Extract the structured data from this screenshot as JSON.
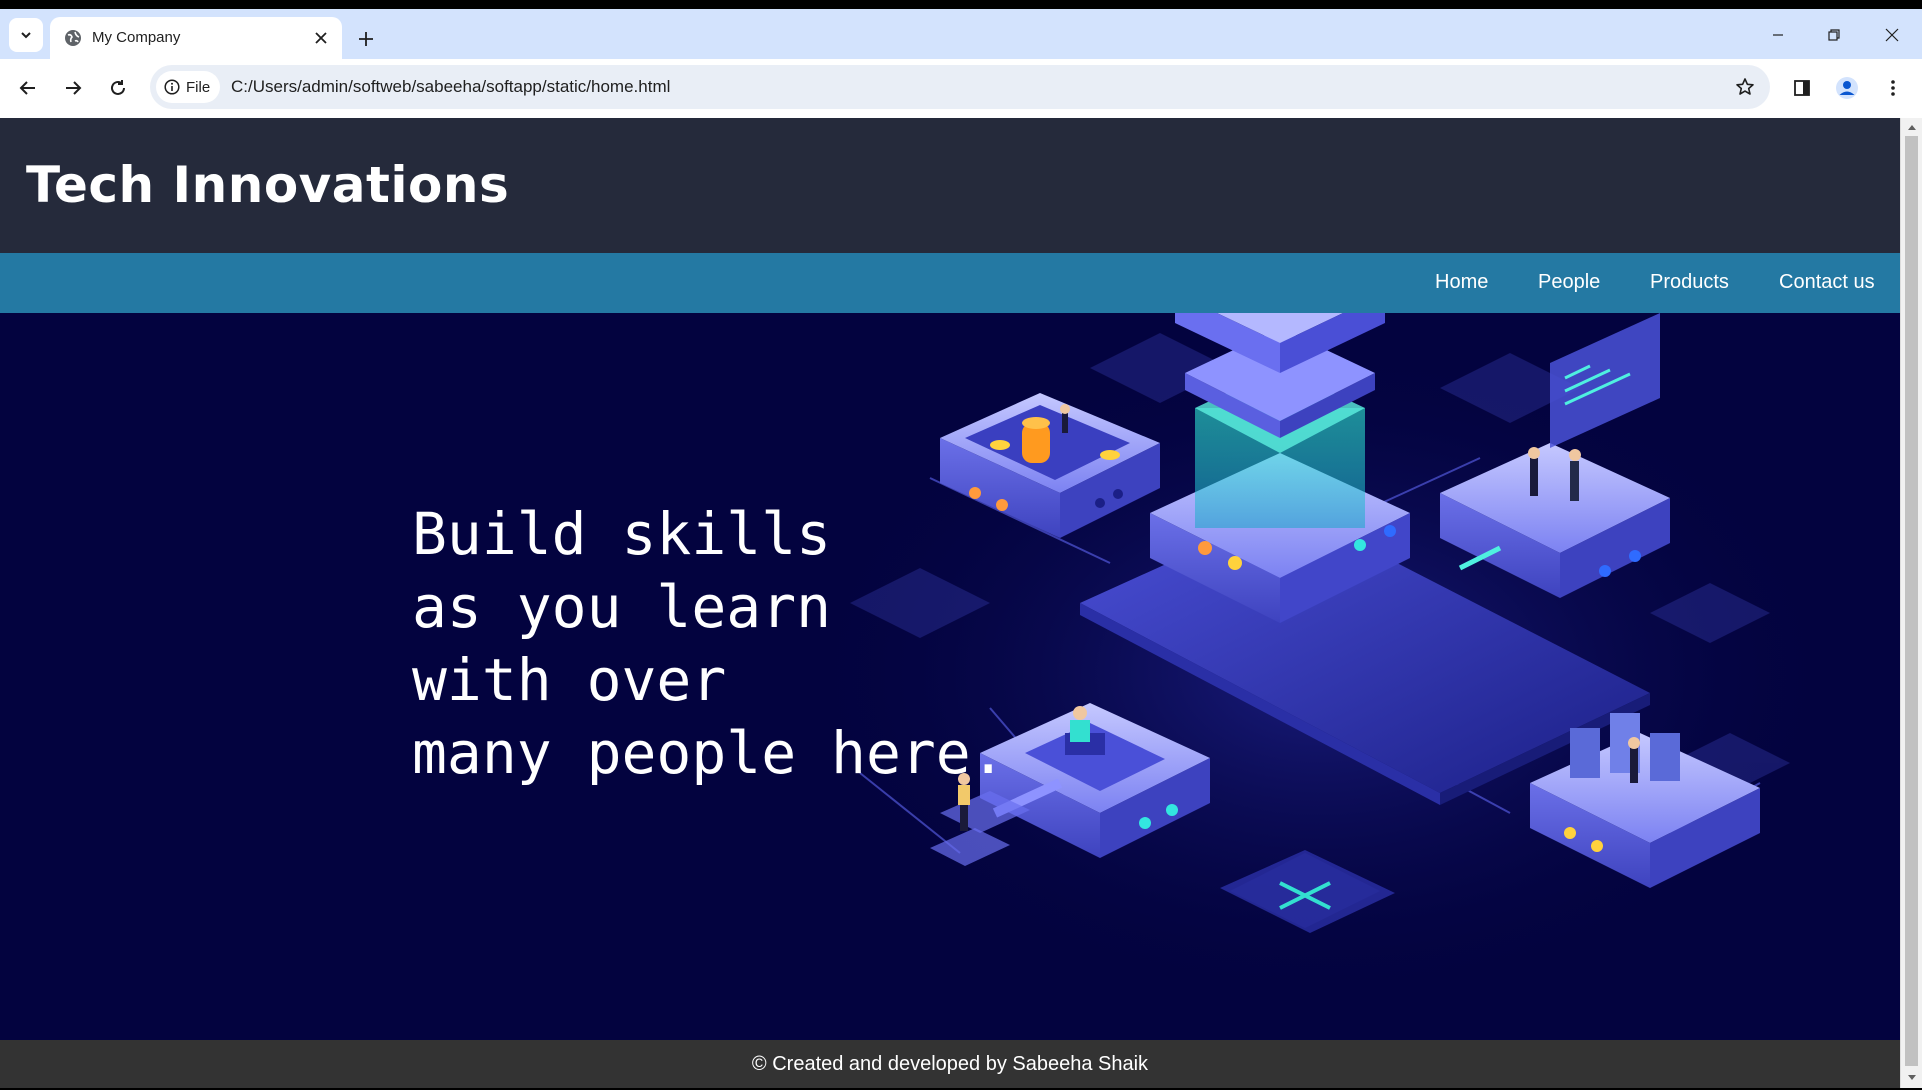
{
  "browser": {
    "tab_title": "My Company",
    "site_chip_label": "File",
    "url": "C:/Users/admin/softweb/sabeeha/softapp/static/home.html"
  },
  "page": {
    "site_title": "Tech Innovations",
    "nav": {
      "items": [
        "Home",
        "People",
        "Products",
        "Contact us"
      ]
    },
    "hero": {
      "lines": [
        "Build skills",
        "as you learn",
        "with over",
        "many people here."
      ]
    },
    "footer": "© Created and developed by Sabeeha Shaik"
  },
  "colors": {
    "header_bg": "#252a3b",
    "nav_bg": "#2479a3",
    "hero_bg": "#03033f",
    "footer_bg": "#333333"
  }
}
